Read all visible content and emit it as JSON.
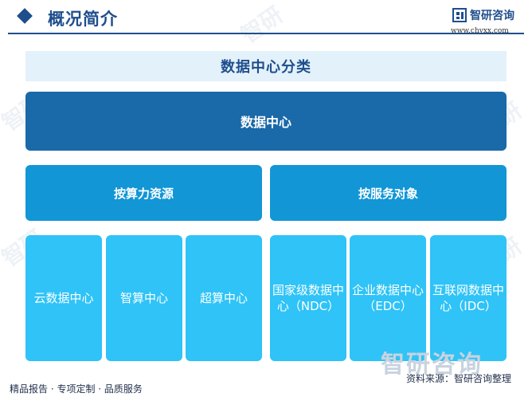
{
  "header": {
    "title": "概况简介",
    "brand_name": "智研咨询",
    "brand_url": "www.chyxx.com"
  },
  "diagram": {
    "banner": "数据中心分类",
    "root": "数据中心",
    "groups": [
      {
        "label": "按算力资源",
        "children": [
          "云数据中心",
          "智算中心",
          "超算中心"
        ]
      },
      {
        "label": "按服务对象",
        "children": [
          "国家级数据中心（NDC）",
          "企业数据中心（EDC）",
          "互联网数据中心（IDC）"
        ]
      }
    ]
  },
  "footer": {
    "left": "精品报告 · 专项定制 · 品质服务",
    "source": "资料来源：智研咨询整理",
    "logo_text": "智研咨询"
  },
  "colors": {
    "header": "#1f4e8c",
    "banner_bg": "#e3f1fa",
    "root": "#1a69a8",
    "group": "#1296d6",
    "leaf": "#2fc3f7"
  }
}
